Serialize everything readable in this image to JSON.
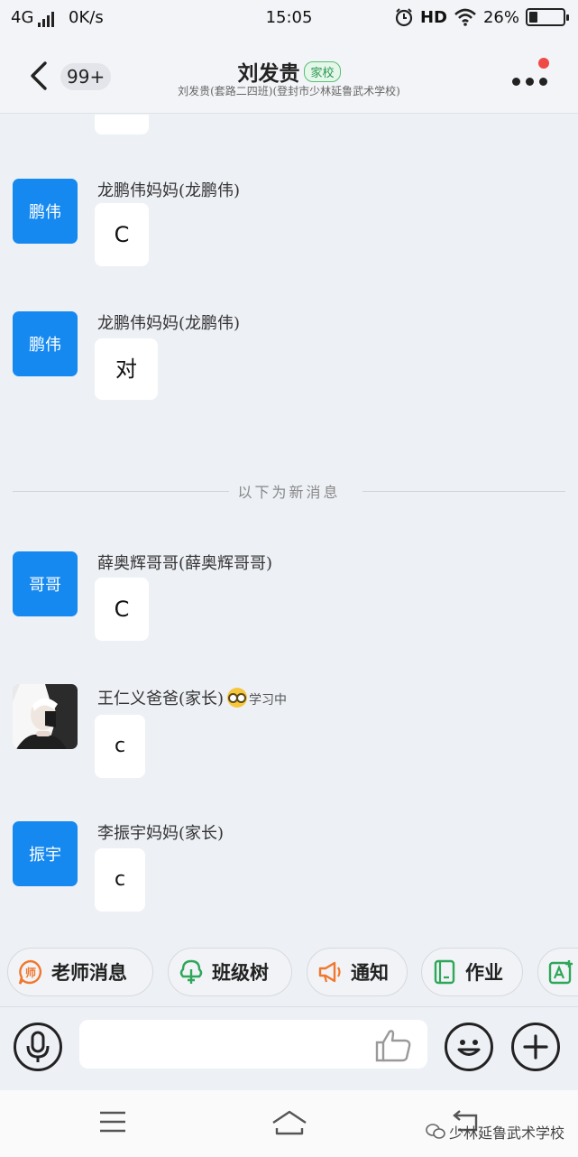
{
  "status_bar": {
    "network": "4G",
    "speed": "0K/s",
    "time": "15:05",
    "hd": "HD",
    "battery_text": "26%",
    "battery_level": 0.26
  },
  "header": {
    "unread_count": "99+",
    "title": "刘发贵",
    "tag": "家校",
    "subtitle": "刘发贵(套路二四班)(登封市少林延鲁武术学校)"
  },
  "messages": [
    {
      "avatar_text": "鹏伟",
      "sender": "龙鹏伟妈妈(龙鹏伟)",
      "text": "C"
    },
    {
      "avatar_text": "鹏伟",
      "sender": "龙鹏伟妈妈(龙鹏伟)",
      "text": "对"
    },
    {
      "avatar_text": "哥哥",
      "sender": "薛奥辉哥哥(薛奥辉哥哥)",
      "text": "C"
    },
    {
      "avatar_text": "",
      "sender": "王仁义爸爸(家长)",
      "status": "学习中",
      "text": "c"
    },
    {
      "avatar_text": "振宇",
      "sender": "李振宇妈妈(家长)",
      "text": "c"
    }
  ],
  "divider_text": "以下为新消息",
  "quick_actions": [
    {
      "label": "老师消息",
      "icon_char": "师"
    },
    {
      "label": "班级树"
    },
    {
      "label": "通知"
    },
    {
      "label": "作业"
    }
  ],
  "input": {
    "value": ""
  },
  "watermark": "少林延鲁武术学校",
  "colors": {
    "avatar_blue": "#1589f0",
    "accent_orange": "#f0772d",
    "accent_green": "#2fa65a",
    "badge_red": "#ef4a46"
  }
}
